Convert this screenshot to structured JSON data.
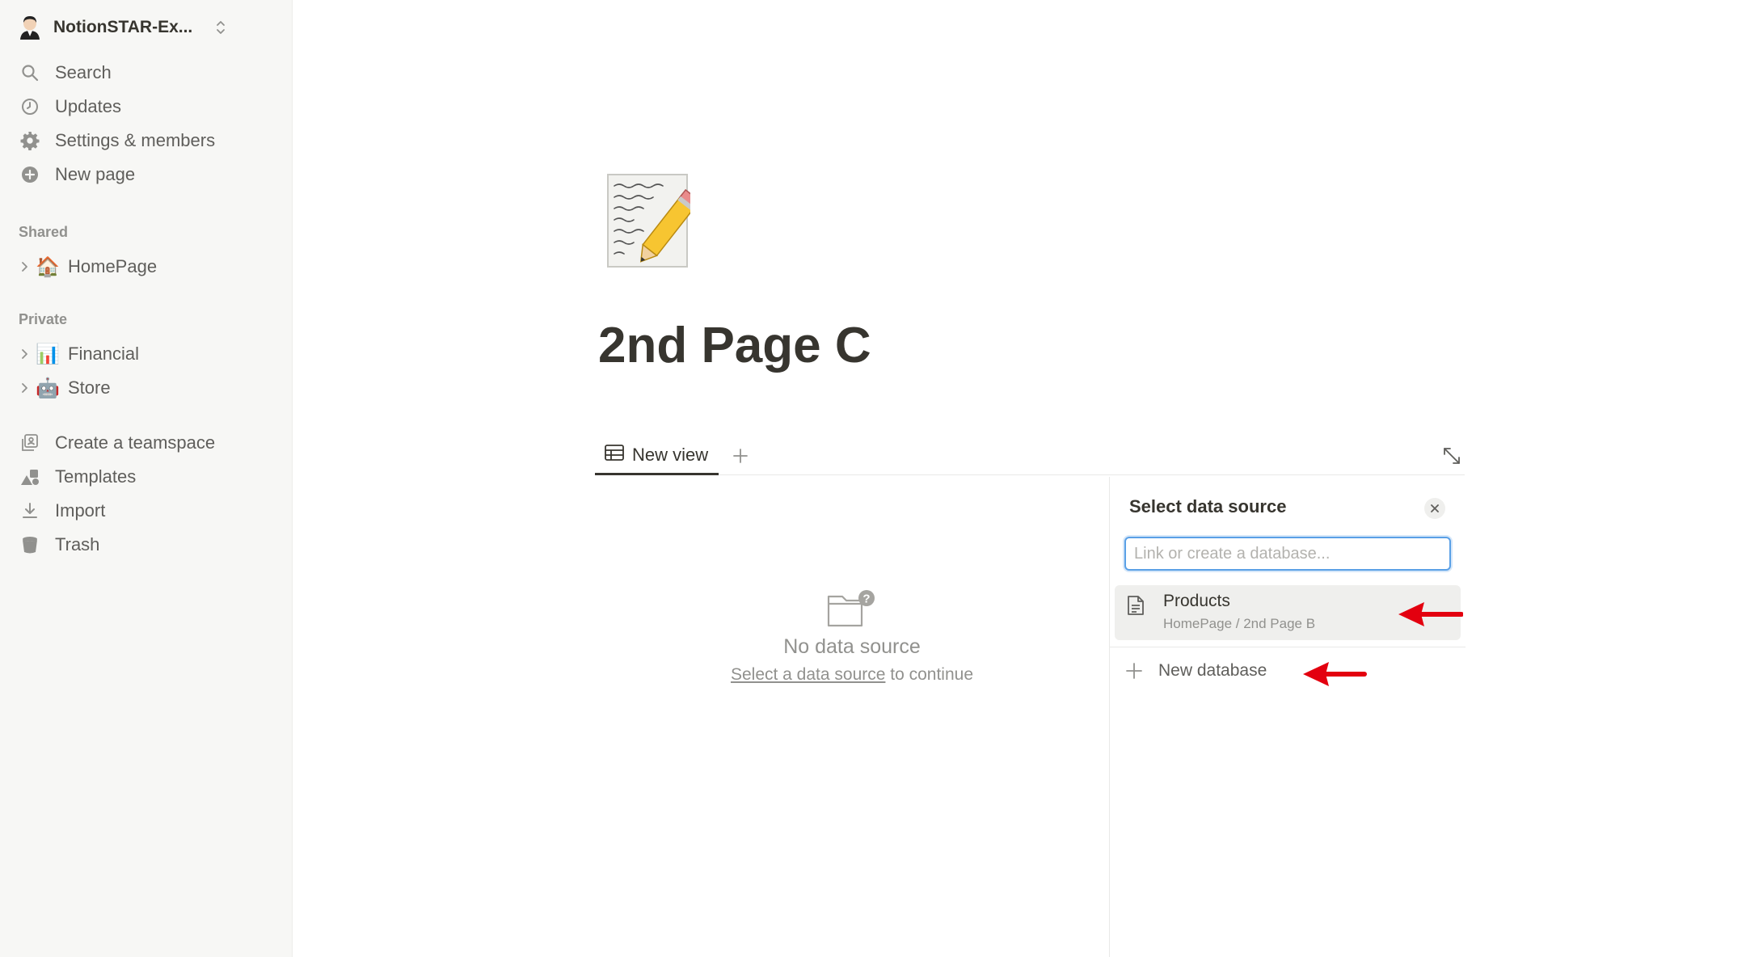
{
  "sidebar": {
    "workspace_name": "NotionSTAR-Ex...",
    "nav": [
      {
        "label": "Search",
        "icon": "search-icon"
      },
      {
        "label": "Updates",
        "icon": "clock-icon"
      },
      {
        "label": "Settings & members",
        "icon": "gear-icon"
      },
      {
        "label": "New page",
        "icon": "plus-circle-icon"
      }
    ],
    "shared_header": "Shared",
    "shared_items": [
      {
        "label": "HomePage",
        "emoji": "🏠"
      }
    ],
    "private_header": "Private",
    "private_items": [
      {
        "label": "Financial",
        "emoji": "📊"
      },
      {
        "label": "Store",
        "emoji": "🤖"
      }
    ],
    "bottom": [
      {
        "label": "Create a teamspace",
        "icon": "teamspace-icon"
      },
      {
        "label": "Templates",
        "icon": "templates-icon"
      },
      {
        "label": "Import",
        "icon": "import-icon"
      },
      {
        "label": "Trash",
        "icon": "trash-icon"
      }
    ]
  },
  "page": {
    "icon": "memo-icon",
    "title": "2nd Page C",
    "tab_label": "New view",
    "empty_title": "No data source",
    "empty_link": "Select a data source",
    "empty_suffix": " to continue"
  },
  "panel": {
    "title": "Select data source",
    "search_placeholder": "Link or create a database...",
    "result_name": "Products",
    "result_path": "HomePage / 2nd Page B",
    "new_database_label": "New database"
  },
  "colors": {
    "accent": "#5aa0e6",
    "annotation_arrow": "#e3000f",
    "sidebar_bg": "#f7f7f5"
  }
}
